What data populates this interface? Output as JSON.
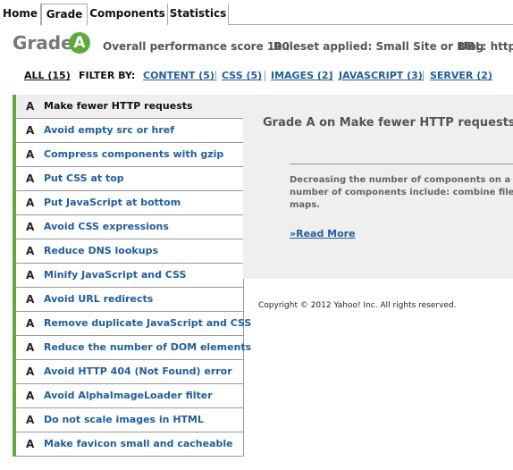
{
  "tabs": [
    {
      "label": "Home",
      "active": false
    },
    {
      "label": "Grade",
      "active": true
    },
    {
      "label": "Components",
      "active": false
    },
    {
      "label": "Statistics",
      "active": false
    }
  ],
  "header": {
    "title": "Grade",
    "grade_letter": "A",
    "score_text": "Overall performance score 100",
    "ruleset_text": "Ruleset applied: Small Site or Blog",
    "url_text": "URL: http:/"
  },
  "filters": {
    "all": "ALL (15)",
    "filter_by": "FILTER BY:",
    "items": [
      {
        "label": "CONTENT (5)"
      },
      {
        "label": "CSS (5)"
      },
      {
        "label": "IMAGES (2)"
      },
      {
        "label": "JAVASCRIPT (3)"
      },
      {
        "label": "SERVER (2)"
      }
    ]
  },
  "rules": [
    {
      "grade": "A",
      "label": "Make fewer HTTP requests",
      "selected": true
    },
    {
      "grade": "A",
      "label": "Avoid empty src or href",
      "selected": false
    },
    {
      "grade": "A",
      "label": "Compress components with gzip",
      "selected": false
    },
    {
      "grade": "A",
      "label": "Put CSS at top",
      "selected": false
    },
    {
      "grade": "A",
      "label": "Put JavaScript at bottom",
      "selected": false
    },
    {
      "grade": "A",
      "label": "Avoid CSS expressions",
      "selected": false
    },
    {
      "grade": "A",
      "label": "Reduce DNS lookups",
      "selected": false
    },
    {
      "grade": "A",
      "label": "Minify JavaScript and CSS",
      "selected": false
    },
    {
      "grade": "A",
      "label": "Avoid URL redirects",
      "selected": false
    },
    {
      "grade": "A",
      "label": "Remove duplicate JavaScript and CSS",
      "selected": false
    },
    {
      "grade": "A",
      "label": "Reduce the number of DOM elements",
      "selected": false
    },
    {
      "grade": "A",
      "label": "Avoid HTTP 404 (Not Found) error",
      "selected": false
    },
    {
      "grade": "A",
      "label": "Avoid AlphaImageLoader filter",
      "selected": false
    },
    {
      "grade": "A",
      "label": "Do not scale images in HTML",
      "selected": false
    },
    {
      "grade": "A",
      "label": "Make favicon small and cacheable",
      "selected": false
    }
  ],
  "detail": {
    "title": "Grade A on Make fewer HTTP requests",
    "description": "Decreasing the number of components on a\nnumber of components include: combine file\nmaps.",
    "read_more": "»Read More"
  },
  "footer": {
    "copyright": "Copyright © 2012 Yahoo! Inc. All rights reserved."
  },
  "colors": {
    "accent_green": "#5eaa3c",
    "link_blue": "#1d5fa0",
    "panel_gray": "#efefef"
  }
}
